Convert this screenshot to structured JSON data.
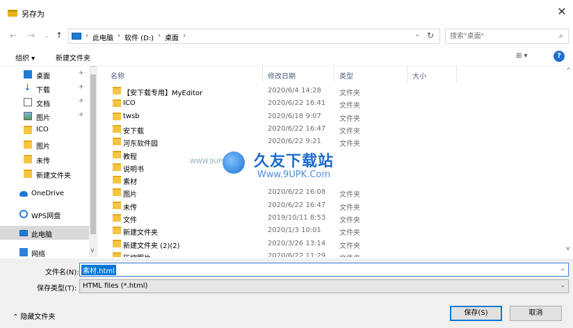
{
  "window": {
    "title": "另存为",
    "close_glyph": "✕"
  },
  "nav": {
    "back": "←",
    "forward": "→",
    "recent": "⌄",
    "up": "↑"
  },
  "address": {
    "crumbs": [
      "此电脑",
      "软件 (D:)",
      "桌面"
    ],
    "sep": "›",
    "chevron": "⌄",
    "refresh": "↻"
  },
  "search": {
    "placeholder": "搜索\"桌面\"",
    "icon": "⌕"
  },
  "toolbar": {
    "organize": "组织 ▾",
    "new_folder": "新建文件夹",
    "view": "⊞ ▾",
    "help": "?"
  },
  "sidebar": {
    "items": [
      {
        "label": "桌面",
        "icon": "desktop-icon",
        "pinned": true
      },
      {
        "label": "下载",
        "icon": "download-icon",
        "pinned": true
      },
      {
        "label": "文档",
        "icon": "document-icon",
        "pinned": true
      },
      {
        "label": "图片",
        "icon": "pictures-icon",
        "pinned": true
      },
      {
        "label": "ICO",
        "icon": "folder-icon",
        "pinned": false
      },
      {
        "label": "图片",
        "icon": "folder-icon",
        "pinned": false
      },
      {
        "label": "未传",
        "icon": "folder-icon",
        "pinned": false
      },
      {
        "label": "新建文件夹",
        "icon": "folder-icon",
        "pinned": false
      },
      {
        "label": "OneDrive",
        "icon": "onedrive-icon",
        "pinned": false
      },
      {
        "label": "WPS网盘",
        "icon": "wps-cloud-icon",
        "pinned": false
      },
      {
        "label": "此电脑",
        "icon": "computer-icon",
        "pinned": false,
        "selected": true
      },
      {
        "label": "网络",
        "icon": "network-icon",
        "pinned": false
      }
    ],
    "pin_glyph": "✈"
  },
  "columns": {
    "name": "名称",
    "modified": "修改日期",
    "type": "类型",
    "size": "大小"
  },
  "files": [
    {
      "name": "【安下载专用】MyEditor",
      "modified": "2020/6/4 14:28",
      "type": "文件夹"
    },
    {
      "name": "ICO",
      "modified": "2020/6/22 16:41",
      "type": "文件夹"
    },
    {
      "name": "twsb",
      "modified": "2020/6/18 9:07",
      "type": "文件夹"
    },
    {
      "name": "安下载",
      "modified": "2020/6/22 16:47",
      "type": "文件夹"
    },
    {
      "name": "河东软件园",
      "modified": "2020/6/22 9:21",
      "type": "文件夹"
    },
    {
      "name": "教程",
      "modified": "",
      "type": ""
    },
    {
      "name": "说明书",
      "modified": "",
      "type": ""
    },
    {
      "name": "素材",
      "modified": "",
      "type": ""
    },
    {
      "name": "图片",
      "modified": "2020/6/22 16:08",
      "type": "文件夹"
    },
    {
      "name": "未传",
      "modified": "2020/6/22 16:47",
      "type": "文件夹"
    },
    {
      "name": "文件",
      "modified": "2019/10/11 8:53",
      "type": "文件夹"
    },
    {
      "name": "新建文件夹",
      "modified": "2020/1/3 10:01",
      "type": "文件夹"
    },
    {
      "name": "新建文件夹 (2)(2)",
      "modified": "2020/3/26 13:14",
      "type": "文件夹"
    },
    {
      "name": "压缩图片",
      "modified": "2020/6/22 11:29",
      "type": "文件夹"
    }
  ],
  "watermark": {
    "brand": "久友下载站",
    "url": "Www.9UPK.Com",
    "left": "WWW.9UPK.COM"
  },
  "footer": {
    "filename_label": "文件名(N):",
    "filename_value": "素材.html",
    "filetype_label": "保存类型(T):",
    "filetype_value": "HTML files (*.html)",
    "hide_folders": "⌃ 隐藏文件夹",
    "save": "保存(S)",
    "cancel": "取消"
  },
  "colors": {
    "accent": "#0078d7",
    "folder": "#f6c443",
    "selected_nav": "#d9d9d9"
  }
}
